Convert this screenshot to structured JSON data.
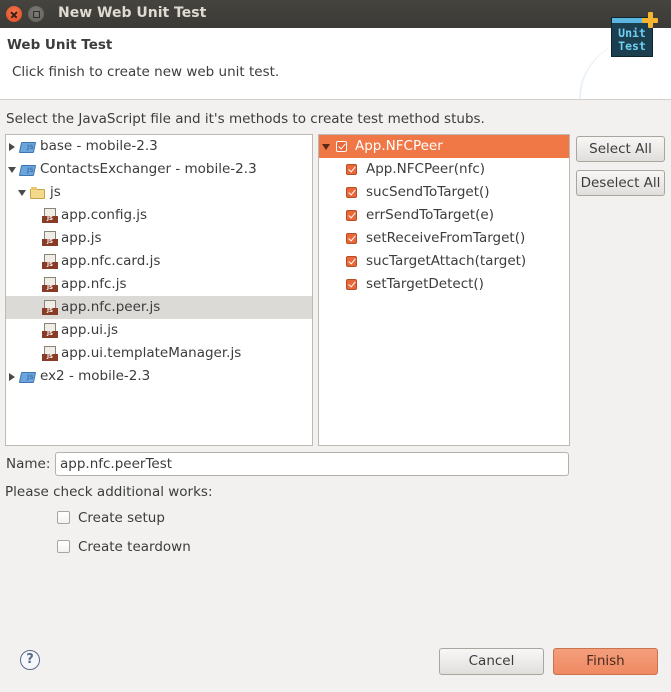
{
  "window": {
    "title": "New Web Unit Test"
  },
  "header": {
    "title": "Web Unit Test",
    "subtitle": "Click finish to create new web unit test.",
    "icon": {
      "name": "unit-test-icon",
      "line1": "Unit",
      "line2": "Test"
    }
  },
  "instruction": "Select the JavaScript file and it's methods to create test method stubs.",
  "tree": {
    "items": [
      {
        "label": "base - mobile-2.3",
        "type": "project",
        "expanded": false,
        "level": 0
      },
      {
        "label": "ContactsExchanger - mobile-2.3",
        "type": "project",
        "expanded": true,
        "level": 0
      },
      {
        "label": "js",
        "type": "folder",
        "expanded": true,
        "level": 1
      },
      {
        "label": "app.config.js",
        "type": "js-file",
        "level": 2
      },
      {
        "label": "app.js",
        "type": "js-file",
        "level": 2
      },
      {
        "label": "app.nfc.card.js",
        "type": "js-file",
        "level": 2
      },
      {
        "label": "app.nfc.js",
        "type": "js-file",
        "level": 2
      },
      {
        "label": "app.nfc.peer.js",
        "type": "js-file",
        "level": 2,
        "selected": true
      },
      {
        "label": "app.ui.js",
        "type": "js-file",
        "level": 2
      },
      {
        "label": "app.ui.templateManager.js",
        "type": "js-file",
        "level": 2
      },
      {
        "label": "ex2 - mobile-2.3",
        "type": "project",
        "expanded": false,
        "level": 0
      }
    ]
  },
  "methods": {
    "class_label": "App.NFCPeer",
    "class_checked": true,
    "items": [
      {
        "label": "App.NFCPeer(nfc)",
        "checked": true
      },
      {
        "label": "sucSendToTarget()",
        "checked": true
      },
      {
        "label": "errSendToTarget(e)",
        "checked": true
      },
      {
        "label": "setReceiveFromTarget()",
        "checked": true
      },
      {
        "label": "sucTargetAttach(target)",
        "checked": true
      },
      {
        "label": "setTargetDetect()",
        "checked": true
      }
    ]
  },
  "buttons": {
    "select_all": "Select All",
    "deselect_all": "Deselect All",
    "cancel": "Cancel",
    "finish": "Finish"
  },
  "name_field": {
    "label": "Name:",
    "value": "app.nfc.peerTest"
  },
  "additional": {
    "label": "Please check additional works:",
    "options": [
      {
        "label": "Create setup",
        "checked": false
      },
      {
        "label": "Create teardown",
        "checked": false
      }
    ]
  },
  "help": {
    "glyph": "?"
  },
  "colors": {
    "accent": "#f07746",
    "finish_button": "#f0906a",
    "titlebar": "#3c3b37"
  }
}
